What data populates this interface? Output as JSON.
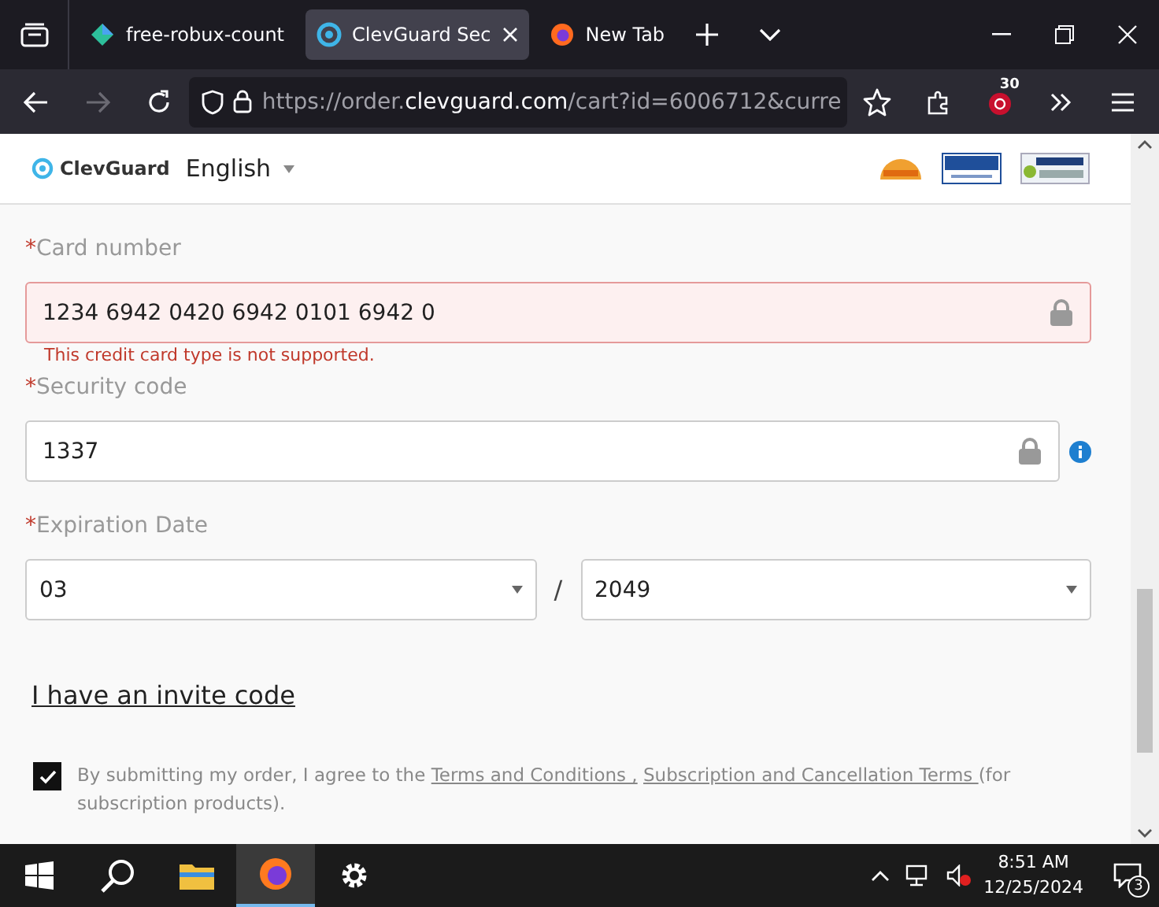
{
  "browser": {
    "tabs": [
      {
        "title": "free-robux-count",
        "selected": false
      },
      {
        "title": "ClevGuard Sec",
        "selected": true
      },
      {
        "title": "New Tab",
        "selected": false
      }
    ],
    "url": {
      "scheme": "https://order.",
      "domain": "clevguard.com",
      "path": "/cart?id=6006712&curre"
    },
    "extension_badge": "30"
  },
  "header": {
    "logo": "ClevGuard",
    "language": "English"
  },
  "form": {
    "required_mark": "*",
    "card_number": {
      "label": "Card number",
      "value": "1234 6942 0420 6942 0101 6942 0",
      "invalid": true,
      "error": "This credit card type is not supported."
    },
    "security_code": {
      "label": "Security code",
      "value": "1337",
      "invalid": false
    },
    "expiration": {
      "label": "Expiration Date",
      "month": "03",
      "separator": "/",
      "year": "2049"
    },
    "invite_link": "I have an invite code",
    "agreement": {
      "checked": true,
      "text_before": "By submitting my order, I agree to the ",
      "link_1": "Terms and Conditions ,",
      "link_2": "Subscription and Cancellation Terms ",
      "text_after": "(for subscription products)."
    }
  },
  "taskbar": {
    "time": "8:51 AM",
    "date": "12/25/2024",
    "notifications": "3"
  }
}
